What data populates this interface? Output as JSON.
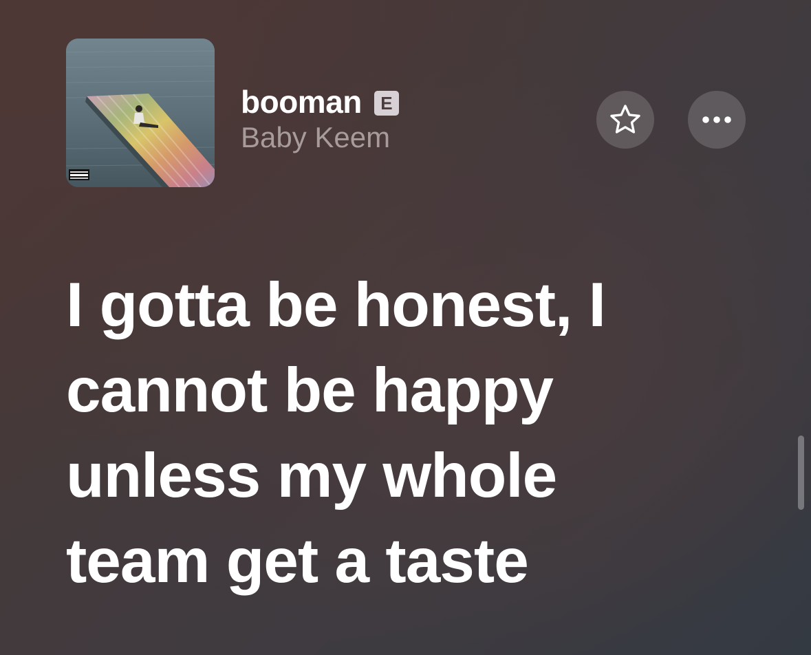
{
  "now_playing": {
    "title": "booman",
    "explicit_badge": "E",
    "artist": "Baby Keem",
    "artwork_icon": "album-artwork"
  },
  "actions": {
    "favorite_icon": "star-icon",
    "more_icon": "ellipsis-icon"
  },
  "lyrics": {
    "lines": [
      "I gotta be honest, I",
      "cannot be happy",
      "unless my whole",
      "team get a taste"
    ]
  },
  "colors": {
    "background_start": "#4a3634",
    "background_end": "#343a42",
    "lyric_text": "#ffffff",
    "artist_text": "#a79b9c",
    "badge_bg": "#d7d0d4"
  }
}
